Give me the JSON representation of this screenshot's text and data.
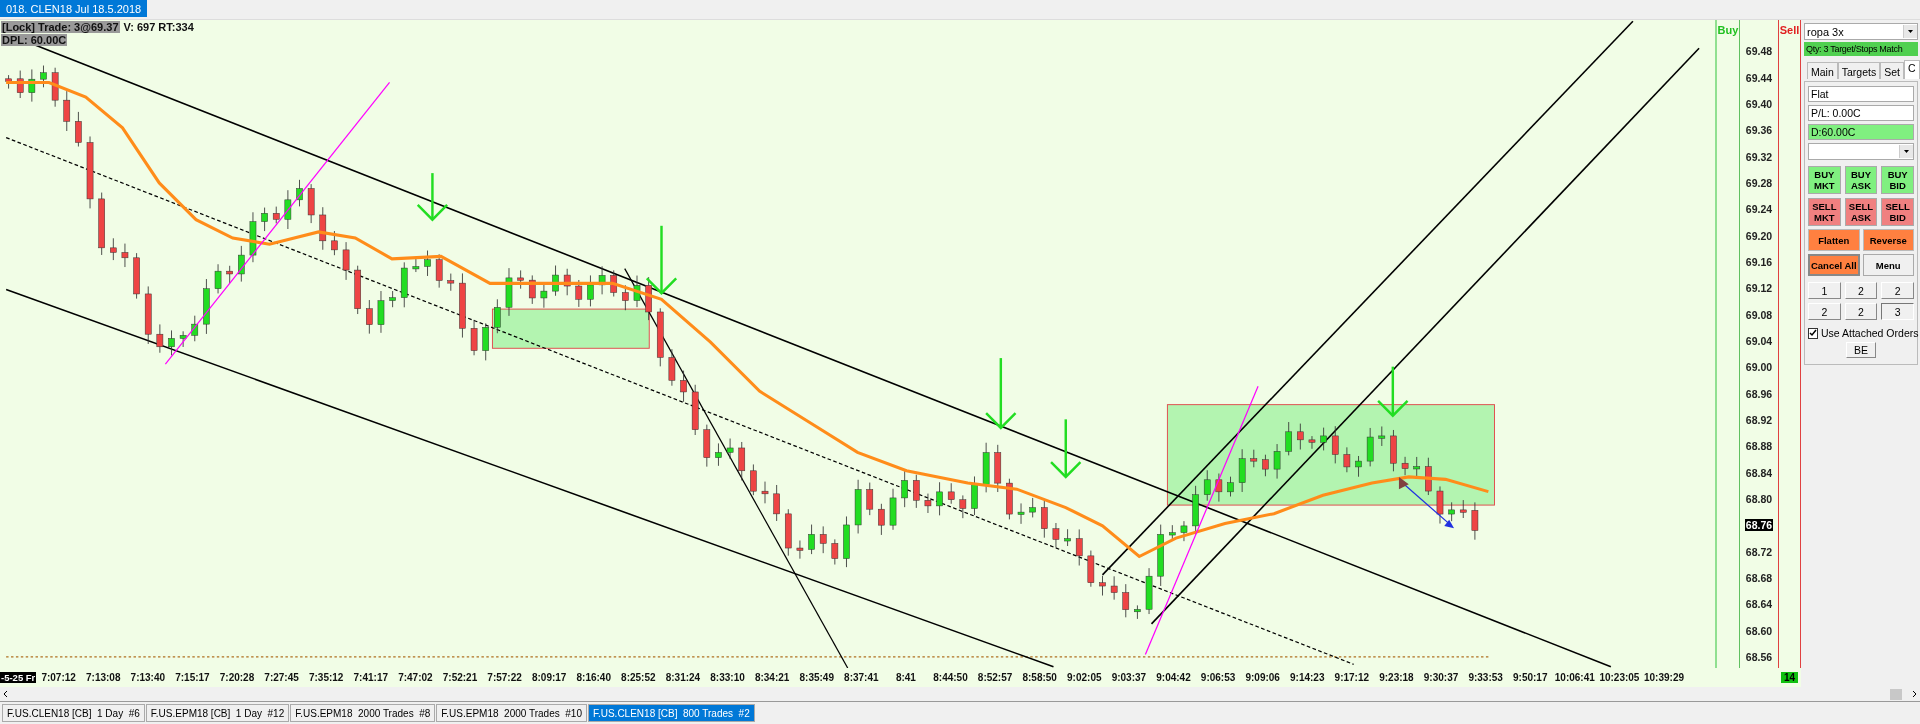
{
  "window_tab": {
    "label": "018. CLEN18 Jul 18.5.2018",
    "selected": true
  },
  "chart": {
    "info_lines": [
      [
        {
          "text": "[Lock] Trade: 3@69.37",
          "highlighted": true
        },
        {
          "text": "V: 697 RT:334",
          "highlighted": false
        }
      ],
      [
        {
          "text": "DPL: 60.00C",
          "highlighted": true
        }
      ]
    ],
    "date_label": "-5-25 Fr",
    "x_labels": [
      "7:07:12",
      "7:13:08",
      "7:13:40",
      "7:15:17",
      "7:20:28",
      "7:27:45",
      "7:35:12",
      "7:41:17",
      "7:47:02",
      "7:52:21",
      "7:57:22",
      "8:09:17",
      "8:16:40",
      "8:25:52",
      "8:31:24",
      "8:33:10",
      "8:34:21",
      "8:35:49",
      "8:37:41",
      "8:41",
      "8:44:50",
      "8:52:57",
      "8:58:50",
      "9:02:05",
      "9:03:37",
      "9:04:42",
      "9:06:53",
      "9:09:06",
      "9:14:23",
      "9:17:12",
      "9:23:18",
      "9:30:37",
      "9:33:53",
      "9:50:17",
      "10:06:41",
      "10:23:05",
      "10:39:29"
    ]
  },
  "price_axis": {
    "buy_label": "Buy",
    "sell_label": "Sell",
    "counter": "14",
    "ticks": [
      {
        "label": "69.48",
        "current": false
      },
      {
        "label": "69.44",
        "current": false
      },
      {
        "label": "69.40",
        "current": false
      },
      {
        "label": "69.36",
        "current": false
      },
      {
        "label": "69.32",
        "current": false
      },
      {
        "label": "69.28",
        "current": false
      },
      {
        "label": "69.24",
        "current": false
      },
      {
        "label": "69.20",
        "current": false
      },
      {
        "label": "69.16",
        "current": false
      },
      {
        "label": "69.12",
        "current": false
      },
      {
        "label": "69.08",
        "current": false
      },
      {
        "label": "69.04",
        "current": false
      },
      {
        "label": "69.00",
        "current": false
      },
      {
        "label": "68.96",
        "current": false
      },
      {
        "label": "68.92",
        "current": false
      },
      {
        "label": "68.88",
        "current": false
      },
      {
        "label": "68.84",
        "current": false
      },
      {
        "label": "68.80",
        "current": false
      },
      {
        "label": "68.76",
        "current": true
      },
      {
        "label": "68.72",
        "current": false
      },
      {
        "label": "68.68",
        "current": false
      },
      {
        "label": "68.64",
        "current": false
      },
      {
        "label": "68.60",
        "current": false
      },
      {
        "label": "68.56",
        "current": false
      }
    ]
  },
  "order_panel": {
    "account": "ropa 3x",
    "status": "Qty: 3 Target/Stops Match",
    "tabs": [
      {
        "label": "Main",
        "selected": false
      },
      {
        "label": "Targets",
        "selected": false
      },
      {
        "label": "Set",
        "selected": false
      },
      {
        "label": "C",
        "selected": true
      }
    ],
    "fields": [
      {
        "value": "Flat",
        "highlighted": false
      },
      {
        "value": "P/L: 0.00C",
        "highlighted": false
      },
      {
        "value": "D:60.00C",
        "highlighted": true
      }
    ],
    "order_buttons": [
      {
        "lines": [
          "BUY",
          "MKT"
        ],
        "kind": "buy"
      },
      {
        "lines": [
          "BUY",
          "ASK"
        ],
        "kind": "buy"
      },
      {
        "lines": [
          "BUY",
          "BID"
        ],
        "kind": "buy"
      },
      {
        "lines": [
          "SELL",
          "MKT"
        ],
        "kind": "sell"
      },
      {
        "lines": [
          "SELL",
          "ASK"
        ],
        "kind": "sell"
      },
      {
        "lines": [
          "SELL",
          "BID"
        ],
        "kind": "sell"
      }
    ],
    "action_buttons": [
      {
        "label": "Flatten",
        "kind": "action"
      },
      {
        "label": "Reverse",
        "kind": "action"
      },
      {
        "label": "Cancel All",
        "kind": "cancel"
      },
      {
        "label": "Menu",
        "kind": "plain"
      }
    ],
    "quantity_buttons": [
      {
        "label": "1",
        "selected": false
      },
      {
        "label": "2",
        "selected": false
      },
      {
        "label": "2",
        "selected": false
      },
      {
        "label": "2",
        "selected": false
      },
      {
        "label": "2",
        "selected": false
      },
      {
        "label": "3",
        "selected": true
      }
    ],
    "attached_orders": {
      "label": "Use Attached Orders",
      "checked": true
    },
    "be_button": "BE"
  },
  "bottom_tabs": [
    {
      "label": "F.US.CLEN18 [CB]  1 Day  #6",
      "selected": false
    },
    {
      "label": "F.US.EPM18 [CB]  1 Day  #12",
      "selected": false
    },
    {
      "label": "F.US.EPM18  2000 Trades  #8",
      "selected": false
    },
    {
      "label": "F.US.EPM18  2000 Trades  #10",
      "selected": false
    },
    {
      "label": "F.US.CLEN18 [CB]  800 Trades  #2",
      "selected": true
    }
  ]
}
